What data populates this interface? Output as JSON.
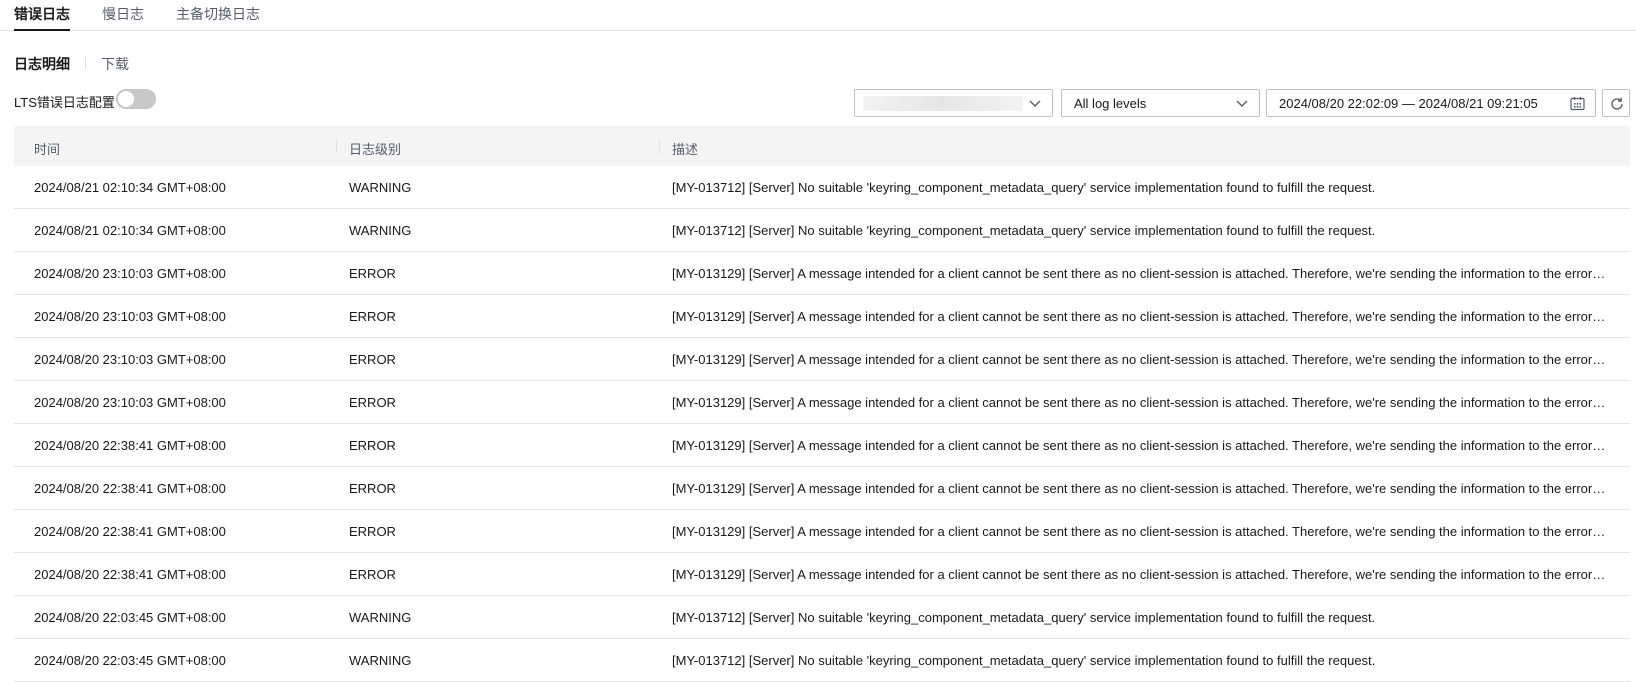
{
  "top_tabs": [
    {
      "label": "错误日志"
    },
    {
      "label": "慢日志"
    },
    {
      "label": "主备切换日志"
    }
  ],
  "sub_tabs": [
    {
      "label": "日志明细"
    },
    {
      "label": "下载"
    }
  ],
  "lts": {
    "label": "LTS错误日志配置",
    "enabled": false
  },
  "filters": {
    "node_select": {
      "value": ""
    },
    "level_select": {
      "value": "All log levels"
    },
    "date_range": {
      "value": "2024/08/20 22:02:09 — 2024/08/21 09:21:05"
    }
  },
  "table": {
    "columns": [
      "时间",
      "日志级别",
      "描述"
    ],
    "rows": [
      {
        "time": "2024/08/21 02:10:34 GMT+08:00",
        "level": "WARNING",
        "desc": "[MY-013712] [Server] No suitable 'keyring_component_metadata_query' service implementation found to fulfill the request."
      },
      {
        "time": "2024/08/21 02:10:34 GMT+08:00",
        "level": "WARNING",
        "desc": "[MY-013712] [Server] No suitable 'keyring_component_metadata_query' service implementation found to fulfill the request."
      },
      {
        "time": "2024/08/20 23:10:03 GMT+08:00",
        "level": "ERROR",
        "desc": "[MY-013129] [Server] A message intended for a client cannot be sent there as no client-session is attached. Therefore, we're sending the information to the error-log instead: ..."
      },
      {
        "time": "2024/08/20 23:10:03 GMT+08:00",
        "level": "ERROR",
        "desc": "[MY-013129] [Server] A message intended for a client cannot be sent there as no client-session is attached. Therefore, we're sending the information to the error-log instead: ..."
      },
      {
        "time": "2024/08/20 23:10:03 GMT+08:00",
        "level": "ERROR",
        "desc": "[MY-013129] [Server] A message intended for a client cannot be sent there as no client-session is attached. Therefore, we're sending the information to the error-log instead: ..."
      },
      {
        "time": "2024/08/20 23:10:03 GMT+08:00",
        "level": "ERROR",
        "desc": "[MY-013129] [Server] A message intended for a client cannot be sent there as no client-session is attached. Therefore, we're sending the information to the error-log instead: ..."
      },
      {
        "time": "2024/08/20 22:38:41 GMT+08:00",
        "level": "ERROR",
        "desc": "[MY-013129] [Server] A message intended for a client cannot be sent there as no client-session is attached. Therefore, we're sending the information to the error-log instead: ..."
      },
      {
        "time": "2024/08/20 22:38:41 GMT+08:00",
        "level": "ERROR",
        "desc": "[MY-013129] [Server] A message intended for a client cannot be sent there as no client-session is attached. Therefore, we're sending the information to the error-log instead: ..."
      },
      {
        "time": "2024/08/20 22:38:41 GMT+08:00",
        "level": "ERROR",
        "desc": "[MY-013129] [Server] A message intended for a client cannot be sent there as no client-session is attached. Therefore, we're sending the information to the error-log instead: ..."
      },
      {
        "time": "2024/08/20 22:38:41 GMT+08:00",
        "level": "ERROR",
        "desc": "[MY-013129] [Server] A message intended for a client cannot be sent there as no client-session is attached. Therefore, we're sending the information to the error-log instead: ..."
      },
      {
        "time": "2024/08/20 22:03:45 GMT+08:00",
        "level": "WARNING",
        "desc": "[MY-013712] [Server] No suitable 'keyring_component_metadata_query' service implementation found to fulfill the request."
      },
      {
        "time": "2024/08/20 22:03:45 GMT+08:00",
        "level": "WARNING",
        "desc": "[MY-013712] [Server] No suitable 'keyring_component_metadata_query' service implementation found to fulfill the request."
      }
    ]
  }
}
